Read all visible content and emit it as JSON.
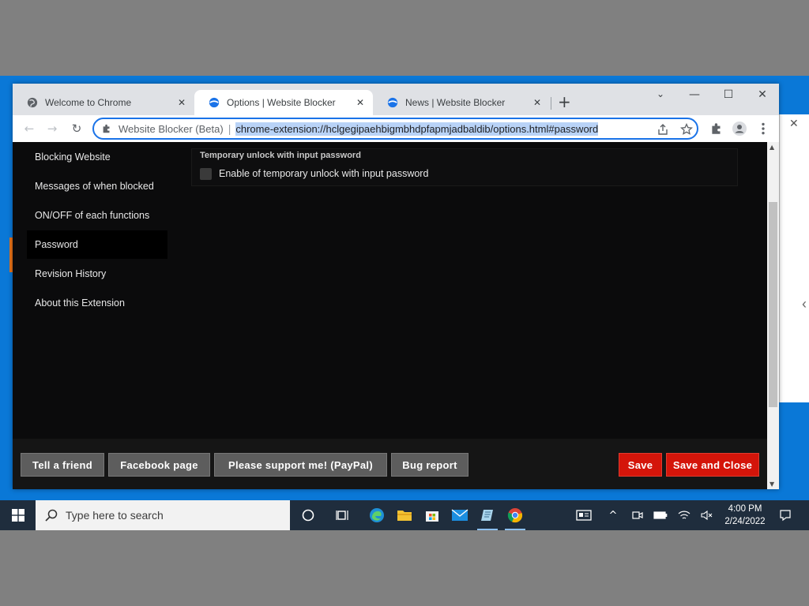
{
  "browser": {
    "tabs": [
      {
        "title": "Welcome to Chrome",
        "icon": "globe-icon"
      },
      {
        "title": "Options | Website Blocker",
        "icon": "website-blocker-icon",
        "active": true
      },
      {
        "title": "News | Website Blocker",
        "icon": "website-blocker-icon"
      }
    ],
    "omnibox": {
      "origin": "Website Blocker (Beta)",
      "separator": "|",
      "url": "chrome-extension://hclgegipaehbigmbhdpfapmjadbaldib/options.html#password"
    }
  },
  "sidebar": {
    "items": [
      {
        "label": "Blocking Website"
      },
      {
        "label": "Messages of when blocked"
      },
      {
        "label": "ON/OFF of each functions"
      },
      {
        "label": "Password",
        "active": true
      },
      {
        "label": "Revision History"
      },
      {
        "label": "About this Extension"
      }
    ]
  },
  "main": {
    "section_title": "Temporary unlock with input password",
    "checkbox_label": "Enable of temporary unlock with input password",
    "checkbox_checked": false
  },
  "footer": {
    "buttons": {
      "tell_friend": "Tell a friend",
      "facebook": "Facebook page",
      "support": "Please support me! (PayPal)",
      "bug_report": "Bug report",
      "save": "Save",
      "save_close": "Save and Close"
    }
  },
  "taskbar": {
    "search_placeholder": "Type here to search",
    "time": "4:00 PM",
    "date": "2/24/2022"
  },
  "colors": {
    "accent": "#1a73e8",
    "save_button": "#d4150a",
    "page_bg": "#0b0b0c",
    "desktop": "#0a78d7"
  }
}
